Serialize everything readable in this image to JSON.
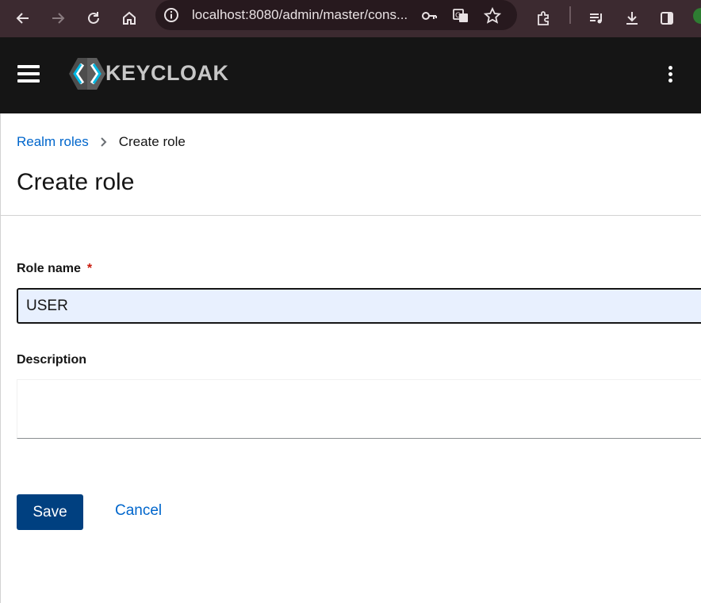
{
  "browser": {
    "url": "localhost:8080/admin/master/cons...",
    "icons": [
      "back-icon",
      "forward-icon",
      "reload-icon",
      "home-icon",
      "site-info-icon",
      "password-key-icon",
      "translate-icon",
      "bookmark-star-icon",
      "extensions-icon",
      "media-queue-icon",
      "download-icon",
      "side-panel-icon"
    ]
  },
  "header": {
    "brand": "KEYCLOAK"
  },
  "breadcrumb": {
    "parent": "Realm roles",
    "current": "Create role"
  },
  "page": {
    "title": "Create role"
  },
  "form": {
    "role_name_label": "Role name",
    "required_marker": "*",
    "role_name_value": "USER",
    "description_label": "Description",
    "description_value": "",
    "save_label": "Save",
    "cancel_label": "Cancel"
  },
  "colors": {
    "primary": "#004080",
    "link": "#0066cc",
    "header_bg": "#151515",
    "browser_bg": "#3c2a30",
    "required": "#c9190b",
    "autofill_bg": "#e8f0fe"
  }
}
